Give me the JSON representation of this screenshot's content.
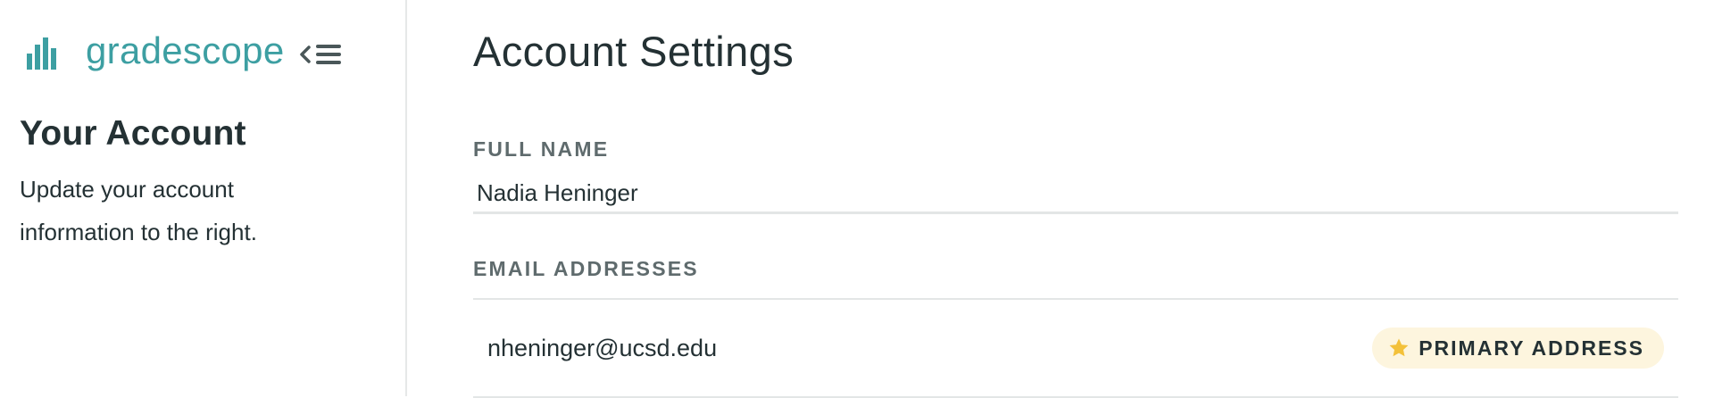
{
  "app": {
    "brand_name": "gradescope",
    "accent_color": "#3d9fa2",
    "logo_icon": "bar-chart-logo-icon",
    "collapse_icon": "collapse-menu-icon"
  },
  "sidebar": {
    "heading": "Your Account",
    "description": "Update your account information to the right."
  },
  "main": {
    "title": "Account Settings",
    "full_name": {
      "label": "FULL NAME",
      "value": "Nadia Heninger"
    },
    "emails": {
      "label": "EMAIL ADDRESSES",
      "items": [
        {
          "address": "nheninger@ucsd.edu",
          "badge": "PRIMARY ADDRESS",
          "badge_icon": "star-icon",
          "badge_color": "#f3c13a"
        }
      ]
    }
  }
}
